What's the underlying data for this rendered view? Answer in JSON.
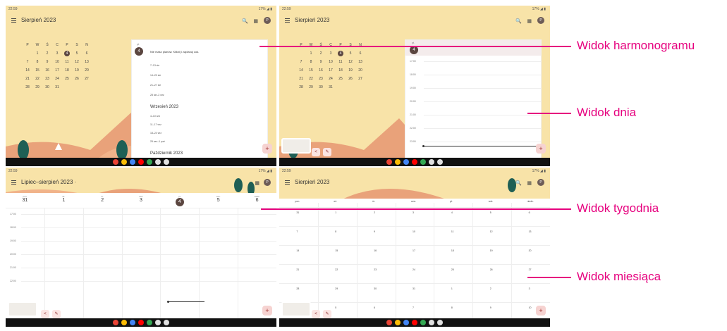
{
  "colors": {
    "accent": "#e6007e",
    "sky": "#f8e3a8",
    "hill": "#e9a27a",
    "today": "#5b4640"
  },
  "quadrants": {
    "schedule": {
      "status_time": "22:59",
      "status_right": "17% ◢ ▮",
      "title": "Sierpień 2023",
      "avatar": "P",
      "mini_calendar": {
        "headers": [
          "P",
          "W",
          "Ś",
          "C",
          "P",
          "S",
          "N"
        ],
        "rows": [
          [
            "",
            "1",
            "2",
            "3",
            "4",
            "5",
            "6"
          ],
          [
            "7",
            "8",
            "9",
            "10",
            "11",
            "12",
            "13"
          ],
          [
            "14",
            "15",
            "16",
            "17",
            "18",
            "19",
            "20"
          ],
          [
            "21",
            "22",
            "23",
            "24",
            "25",
            "26",
            "27"
          ],
          [
            "28",
            "29",
            "30",
            "31",
            "",
            "",
            ""
          ]
        ],
        "today": "4"
      },
      "panel": {
        "day_abbr": "pt.",
        "day_num": "4",
        "empty_text": "Nie masz planów. Kliknij i zaplanuj coś.",
        "aug_ranges": [
          "7–13 sie",
          "14–20 sie",
          "21–27 sie",
          "28 sie–3 wrz"
        ],
        "sep_title": "Wrzesień 2023",
        "sep_ranges": [
          "4–10 wrz",
          "11–17 wrz",
          "18–24 wrz",
          "25 wrz–1 paź"
        ],
        "oct_title": "Październik 2023"
      }
    },
    "day": {
      "status_time": "22:59",
      "status_right": "17% ◢ ▮",
      "title": "Sierpień 2023",
      "avatar": "P",
      "day_abbr": "pt.",
      "day_num": "4",
      "hours": [
        "17:00",
        "18:00",
        "19:00",
        "20:00",
        "21:00",
        "22:00",
        "23:00"
      ],
      "mini_calendar": {
        "headers": [
          "P",
          "W",
          "Ś",
          "C",
          "P",
          "S",
          "N"
        ],
        "rows": [
          [
            "",
            "1",
            "2",
            "3",
            "4",
            "5",
            "6"
          ],
          [
            "7",
            "8",
            "9",
            "10",
            "11",
            "12",
            "13"
          ],
          [
            "14",
            "15",
            "16",
            "17",
            "18",
            "19",
            "20"
          ],
          [
            "21",
            "22",
            "23",
            "24",
            "25",
            "26",
            "27"
          ],
          [
            "28",
            "29",
            "30",
            "31",
            "",
            "",
            ""
          ]
        ],
        "today": "4"
      }
    },
    "week": {
      "status_time": "22:59",
      "status_right": "17% ◢ ▮",
      "title": "Lipiec–sierpień 2023 ·",
      "avatar": "P",
      "days": [
        {
          "dn": "pon.",
          "num": "31"
        },
        {
          "dn": "wt.",
          "num": "1"
        },
        {
          "dn": "śr.",
          "num": "2"
        },
        {
          "dn": "czw.",
          "num": "3"
        },
        {
          "dn": "pt.",
          "num": "4"
        },
        {
          "dn": "sob.",
          "num": "5"
        },
        {
          "dn": "niedz.",
          "num": "6"
        }
      ],
      "hours": [
        "17:00",
        "18:00",
        "19:00",
        "20:00",
        "21:00",
        "22:00"
      ]
    },
    "month": {
      "status_time": "22:59",
      "status_right": "17% ◢ ▮",
      "title": "Sierpień 2023",
      "avatar": "P",
      "headers": [
        "pon.",
        "wt.",
        "śr.",
        "czw.",
        "pt.",
        "sob.",
        "niedz."
      ],
      "rows": [
        [
          "31",
          "1",
          "2",
          "3",
          "4",
          "5",
          "6"
        ],
        [
          "7",
          "8",
          "9",
          "10",
          "11",
          "12",
          "13"
        ],
        [
          "14",
          "15",
          "16",
          "17",
          "18",
          "19",
          "20"
        ],
        [
          "21",
          "22",
          "23",
          "24",
          "25",
          "26",
          "27"
        ],
        [
          "28",
          "29",
          "30",
          "31",
          "1",
          "2",
          "3"
        ],
        [
          "4",
          "5",
          "6",
          "7",
          "8",
          "9",
          "10"
        ]
      ]
    }
  },
  "labels": {
    "schedule": "Widok harmonogramu",
    "day": "Widok dnia",
    "week": "Widok tygodnia",
    "month": "Widok miesiąca"
  },
  "icons": {
    "menu": "menu-icon",
    "search": "search-icon",
    "calendar": "calendar-icon",
    "add": "add-icon",
    "share": "share-icon",
    "edit": "edit-icon"
  },
  "symbols": {
    "search": "🔍",
    "calendar": "▦",
    "add": "+",
    "share": "<",
    "edit": "✎"
  }
}
